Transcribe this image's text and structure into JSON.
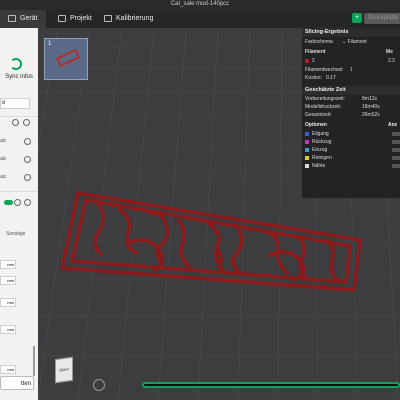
{
  "window": {
    "title": "Cat_sale mod-140pcc"
  },
  "topbar": {
    "tabs": [
      {
        "label": "Gerät",
        "icon": "printer-icon"
      },
      {
        "label": "Projekt",
        "icon": "project-icon"
      },
      {
        "label": "Kalibrierung",
        "icon": "calibration-icon"
      }
    ],
    "slice_icon": "plus-icon",
    "print_label": "Druckplatte"
  },
  "sidebar": {
    "sync_label": "Sync infos",
    "field_partial": "d",
    "rows": [
      "aic",
      "aic",
      "aic"
    ],
    "sonstige_label": "Sonstige",
    "unit_labels": [
      "mm",
      "mm",
      "mm",
      "mm",
      "mm"
    ],
    "bottom_button": "tten"
  },
  "plate": {
    "number": "1"
  },
  "slicing": {
    "title": "Slicing-Ergebnis",
    "farbschema_label": "Farbschema",
    "farbschema_value": "Filament",
    "filament_header": "Filament",
    "menge_header": "Me",
    "filament_item": "2",
    "filament_amount": "2.2",
    "filamentwechsel_label": "Filamentwechsel:",
    "filamentwechsel_value": "1",
    "kosten_label": "Kosten:",
    "kosten_value": "0.17",
    "time_title": "Geschätzte Zeit",
    "vorbereitung_label": "Vorbereitungszeit:",
    "vorbereitung_value": "8m12s",
    "modell_label": "Modelldruckzeit:",
    "modell_value": "18m40s",
    "gesamt_label": "Gesamtzeit:",
    "gesamt_value": "26m52s",
    "optionen_label": "Optionen",
    "anzeige_label": "Anz",
    "options": [
      {
        "label": "Eilgang",
        "color": "#3b5bd6"
      },
      {
        "label": "Rückzug",
        "color": "#c03ac0"
      },
      {
        "label": "Einzug",
        "color": "#3aa0d0"
      },
      {
        "label": "Reinigen",
        "color": "#e0d020"
      },
      {
        "label": "Nähte",
        "color": "#d8d8d8"
      }
    ]
  },
  "bottom": {
    "cube_label": "Oben"
  },
  "colors": {
    "accent": "#0aa35a",
    "model": "#8c1a1a",
    "background": "#3d3d40"
  }
}
